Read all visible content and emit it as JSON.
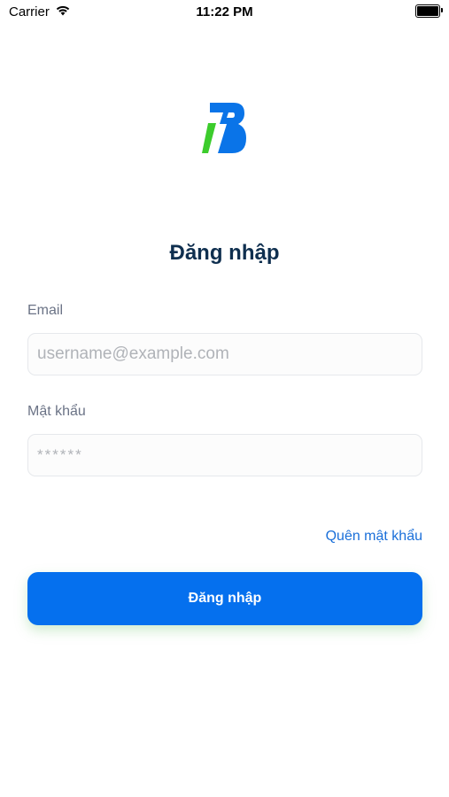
{
  "status_bar": {
    "carrier": "Carrier",
    "time": "11:22 PM",
    "icons": [
      "wifi-icon",
      "battery-icon"
    ]
  },
  "logo": {
    "icon": "brand-logo-icon",
    "colors": {
      "blue": "#0a74e8",
      "green": "#3ccc2c"
    }
  },
  "login": {
    "title": "Đăng nhập",
    "email_label": "Email",
    "email_placeholder": "username@example.com",
    "email_value": "",
    "password_label": "Mật khẩu",
    "password_placeholder": "******",
    "password_value": "",
    "forgot_password": "Quên mật khẩu",
    "submit_label": "Đăng nhập"
  },
  "colors": {
    "accent": "#0570ee",
    "title": "#0f2f4f",
    "label": "#6b7386",
    "link": "#1a6fd9"
  }
}
